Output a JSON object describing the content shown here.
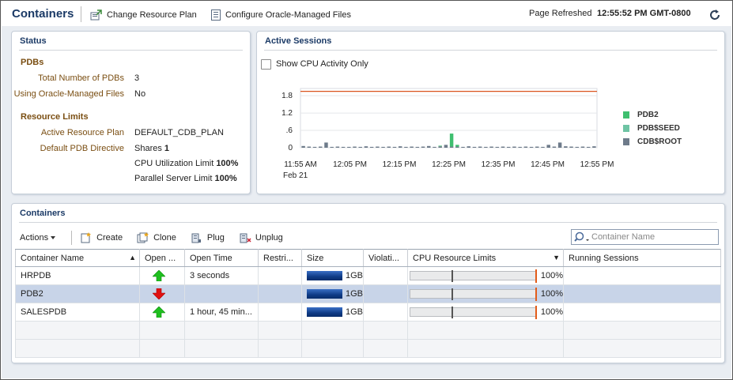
{
  "header": {
    "title": "Containers",
    "change_plan": "Change Resource Plan",
    "configure_omf": "Configure Oracle-Managed Files",
    "refresh_label": "Page Refreshed",
    "refresh_time": "12:55:52 PM GMT-0800"
  },
  "status": {
    "title": "Status",
    "pdbs_heading": "PDBs",
    "total_label": "Total Number of PDBs",
    "total_value": "3",
    "omf_label": "Using Oracle-Managed Files",
    "omf_value": "No",
    "rl_heading": "Resource Limits",
    "plan_label": "Active Resource Plan",
    "plan_value": "DEFAULT_CDB_PLAN",
    "directive_label": "Default PDB Directive",
    "shares_label": "Shares",
    "shares_value": "1",
    "cpu_label": "CPU Utilization Limit",
    "cpu_value": "100%",
    "parallel_label": "Parallel Server Limit",
    "parallel_value": "100%"
  },
  "sessions": {
    "title": "Active Sessions",
    "checkbox_label": "Show CPU Activity Only",
    "checkbox_checked": false
  },
  "chart_data": {
    "type": "bar",
    "stacked": true,
    "x_labels": [
      "11:55 AM",
      "12:05 PM",
      "12:15 PM",
      "12:25 PM",
      "12:35 PM",
      "12:45 PM",
      "12:55 PM"
    ],
    "x_sublabel": "Feb 21",
    "y_ticks": [
      "1.8",
      "1.2",
      ".6",
      "0"
    ],
    "y_tick_values": [
      1.8,
      1.2,
      0.6,
      0
    ],
    "ylim": [
      0,
      2.05
    ],
    "limit_line": 1.95,
    "limit_color": "#d9541e",
    "grid": true,
    "legend_position": "right",
    "series": [
      {
        "name": "PDB2",
        "color": "#3fbf6f",
        "values": [
          0,
          0,
          0,
          0,
          0,
          0,
          0,
          0,
          0,
          0,
          0,
          0,
          0,
          0,
          0,
          0,
          0,
          0,
          0,
          0,
          0,
          0,
          0,
          0,
          0.02,
          0,
          0.45,
          0.06,
          0,
          0,
          0,
          0,
          0,
          0,
          0,
          0,
          0,
          0,
          0,
          0,
          0,
          0,
          0,
          0,
          0,
          0,
          0,
          0,
          0,
          0,
          0,
          0
        ]
      },
      {
        "name": "PDB$SEED",
        "color": "#6ec4a4",
        "values": [
          0,
          0,
          0,
          0,
          0,
          0,
          0,
          0,
          0,
          0,
          0,
          0,
          0,
          0,
          0,
          0,
          0,
          0,
          0,
          0,
          0,
          0,
          0,
          0,
          0,
          0,
          0,
          0,
          0,
          0,
          0,
          0,
          0,
          0,
          0,
          0,
          0,
          0,
          0,
          0,
          0,
          0,
          0,
          0,
          0,
          0,
          0,
          0,
          0,
          0,
          0,
          0
        ]
      },
      {
        "name": "CDB$ROOT",
        "color": "#6e7b8a",
        "values": [
          0.06,
          0.04,
          0.03,
          0.04,
          0.18,
          0.03,
          0.04,
          0.03,
          0.03,
          0.04,
          0.03,
          0.05,
          0.03,
          0.04,
          0.03,
          0.04,
          0.03,
          0.05,
          0.03,
          0.04,
          0.03,
          0.04,
          0.06,
          0.03,
          0.05,
          0.1,
          0.04,
          0.04,
          0.03,
          0.05,
          0.03,
          0.04,
          0.03,
          0.04,
          0.03,
          0.04,
          0.03,
          0.04,
          0.03,
          0.04,
          0.03,
          0.04,
          0.03,
          0.1,
          0.04,
          0.18,
          0.05,
          0.04,
          0.03,
          0.04,
          0.03,
          0.05
        ]
      }
    ]
  },
  "containers": {
    "title": "Containers",
    "actions": "Actions",
    "create": "Create",
    "clone": "Clone",
    "plug": "Plug",
    "unplug": "Unplug",
    "search_placeholder": "Container Name",
    "columns": [
      "Container Name",
      "Open ...",
      "Open Time",
      "Restri...",
      "Size",
      "Violati...",
      "CPU Resource Limits",
      "Running Sessions"
    ],
    "rows": [
      {
        "name": "HRPDB",
        "open": "up",
        "open_time": "3 seconds",
        "size": "1GB",
        "size_fraction": 0.72,
        "cpu_share": 0.33,
        "cpu_limit": "100%"
      },
      {
        "name": "PDB2",
        "open": "down",
        "open_time": "",
        "size": "1GB",
        "size_fraction": 0.72,
        "cpu_share": 0.33,
        "cpu_limit": "100%"
      },
      {
        "name": "SALESPDB",
        "open": "up",
        "open_time": "1 hour, 45 min...",
        "size": "1GB",
        "size_fraction": 0.72,
        "cpu_share": 0.33,
        "cpu_limit": "100%"
      }
    ]
  },
  "colors": {
    "title_blue": "#1b3a66",
    "label_brown": "#7a4e12",
    "selected_row": "#c8d4e8",
    "up_arrow": "#1fbf1f",
    "down_arrow": "#e01010"
  }
}
